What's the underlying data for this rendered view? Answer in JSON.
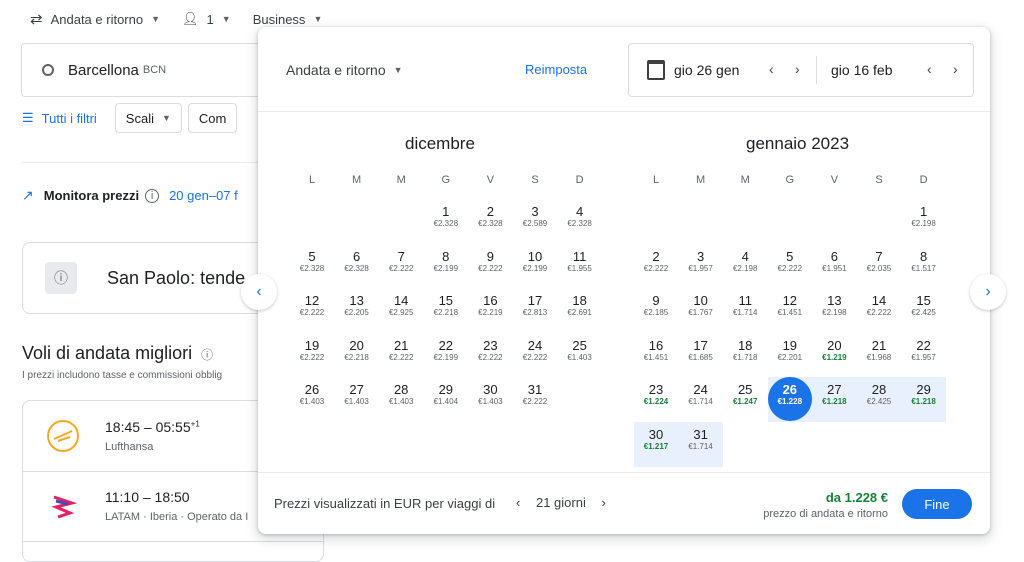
{
  "topbar": {
    "trip_type": "Andata e ritorno",
    "passengers": "1",
    "cabin": "Business"
  },
  "origin": {
    "city": "Barcellona",
    "code": "BCN"
  },
  "filters": {
    "all_filters": "Tutti i filtri",
    "stops": "Scali",
    "more": "Com"
  },
  "tracking": {
    "label": "Monitora prezzi",
    "dates": "20 gen–07 f"
  },
  "info_card": {
    "text": "San Paolo: tende"
  },
  "section": {
    "title": "Voli di andata migliori",
    "subtitle": "I prezzi includono tasse e commissioni obblig"
  },
  "flights": [
    {
      "time": "18:45 – 05:55",
      "plus": "+1",
      "airline": "Lufthansa"
    },
    {
      "time": "11:10 – 18:50",
      "plus": "",
      "airline": "LATAM · Iberia · Operato da I"
    }
  ],
  "popup": {
    "trip_type": "Andata e ritorno",
    "reset": "Reimposta",
    "depart_date": "gio 26 gen",
    "return_date": "gio 16 feb",
    "footer_note": "Prezzi visualizzati in EUR per viaggi di",
    "duration": "21 giorni",
    "from_price": "da 1.228 €",
    "from_sub": "prezzo di andata e ritorno",
    "done": "Fine"
  },
  "weekdays": [
    "L",
    "M",
    "M",
    "G",
    "V",
    "S",
    "D"
  ],
  "months": [
    {
      "name": "dicembre",
      "offset": 3,
      "days": [
        {
          "d": "1",
          "p": "€2.328"
        },
        {
          "d": "2",
          "p": "€2.328"
        },
        {
          "d": "3",
          "p": "€2.589"
        },
        {
          "d": "4",
          "p": "€2.328"
        },
        {
          "d": "5",
          "p": "€2.328"
        },
        {
          "d": "6",
          "p": "€2.328"
        },
        {
          "d": "7",
          "p": "€2.222"
        },
        {
          "d": "8",
          "p": "€2.199"
        },
        {
          "d": "9",
          "p": "€2.222"
        },
        {
          "d": "10",
          "p": "€2.199"
        },
        {
          "d": "11",
          "p": "€1.955"
        },
        {
          "d": "12",
          "p": "€2.222"
        },
        {
          "d": "13",
          "p": "€2.205"
        },
        {
          "d": "14",
          "p": "€2.925"
        },
        {
          "d": "15",
          "p": "€2.218"
        },
        {
          "d": "16",
          "p": "€2.219"
        },
        {
          "d": "17",
          "p": "€2.813"
        },
        {
          "d": "18",
          "p": "€2.691"
        },
        {
          "d": "19",
          "p": "€2.222"
        },
        {
          "d": "20",
          "p": "€2.218"
        },
        {
          "d": "21",
          "p": "€2.222"
        },
        {
          "d": "22",
          "p": "€2.199"
        },
        {
          "d": "23",
          "p": "€2.222"
        },
        {
          "d": "24",
          "p": "€2.222"
        },
        {
          "d": "25",
          "p": "€1.403"
        },
        {
          "d": "26",
          "p": "€1.403"
        },
        {
          "d": "27",
          "p": "€1.403"
        },
        {
          "d": "28",
          "p": "€1.403"
        },
        {
          "d": "29",
          "p": "€1.404"
        },
        {
          "d": "30",
          "p": "€1.403"
        },
        {
          "d": "31",
          "p": "€2.222"
        }
      ]
    },
    {
      "name": "gennaio 2023",
      "offset": 6,
      "days": [
        {
          "d": "1",
          "p": "€2.198"
        },
        {
          "d": "2",
          "p": "€2.222"
        },
        {
          "d": "3",
          "p": "€1.957"
        },
        {
          "d": "4",
          "p": "€2.198"
        },
        {
          "d": "5",
          "p": "€2.222"
        },
        {
          "d": "6",
          "p": "€1.951"
        },
        {
          "d": "7",
          "p": "€2.035"
        },
        {
          "d": "8",
          "p": "€1.517"
        },
        {
          "d": "9",
          "p": "€2.185"
        },
        {
          "d": "10",
          "p": "€1.767"
        },
        {
          "d": "11",
          "p": "€1.714"
        },
        {
          "d": "12",
          "p": "€1.451"
        },
        {
          "d": "13",
          "p": "€2.198"
        },
        {
          "d": "14",
          "p": "€2.222"
        },
        {
          "d": "15",
          "p": "€2.425"
        },
        {
          "d": "16",
          "p": "€1.451"
        },
        {
          "d": "17",
          "p": "€1.685"
        },
        {
          "d": "18",
          "p": "€1.718"
        },
        {
          "d": "19",
          "p": "€2.201"
        },
        {
          "d": "20",
          "p": "€1.219",
          "g": true
        },
        {
          "d": "21",
          "p": "€1.968"
        },
        {
          "d": "22",
          "p": "€1.957"
        },
        {
          "d": "23",
          "p": "€1.224",
          "g": true
        },
        {
          "d": "24",
          "p": "€1.714"
        },
        {
          "d": "25",
          "p": "€1.247",
          "g": true
        },
        {
          "d": "26",
          "p": "€1.228",
          "sel": true
        },
        {
          "d": "27",
          "p": "€1.218",
          "g": true
        },
        {
          "d": "28",
          "p": "€2.425"
        },
        {
          "d": "29",
          "p": "€1.218",
          "g": true
        },
        {
          "d": "30",
          "p": "€1.217",
          "g": true
        },
        {
          "d": "31",
          "p": "€1.714"
        }
      ]
    }
  ]
}
